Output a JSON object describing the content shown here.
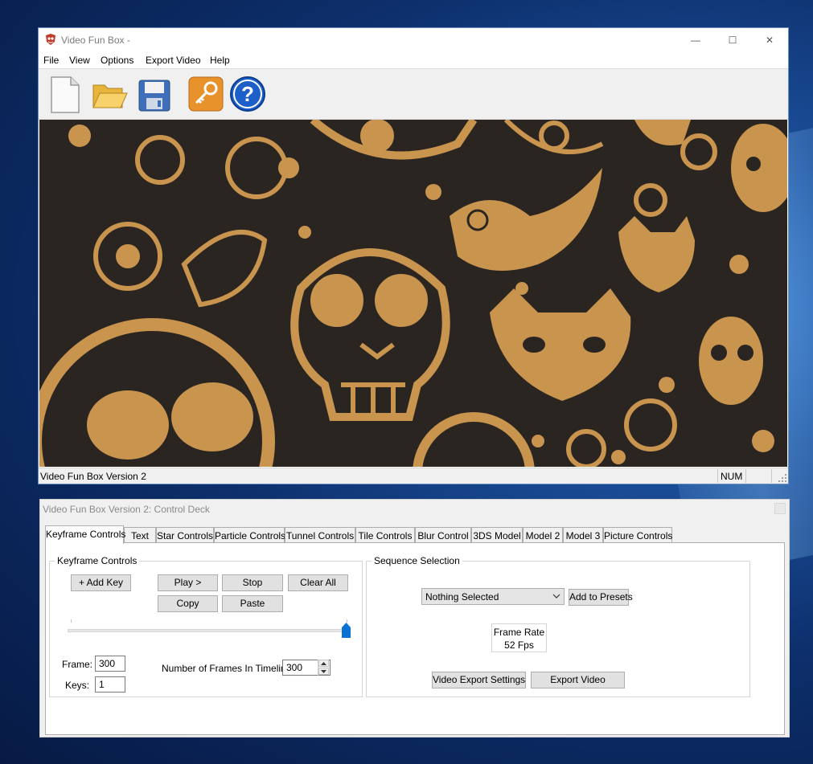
{
  "main_window": {
    "title": "Video Fun Box -",
    "caption_buttons": {
      "minimize": "—",
      "maximize": "☐",
      "close": "✕"
    },
    "menu": [
      "File",
      "View",
      "Options",
      "Export Video",
      "Help"
    ],
    "toolbar": [
      {
        "icon": "new-document-icon"
      },
      {
        "icon": "open-folder-icon"
      },
      {
        "icon": "save-floppy-icon"
      },
      {
        "icon": "key-icon"
      },
      {
        "icon": "help-icon",
        "glyph": "?"
      }
    ],
    "canvas": {
      "background": "#2b2522",
      "pattern_color": "#c8944e"
    },
    "status": {
      "text": "Video Fun Box Version 2",
      "num": "NUM"
    }
  },
  "control_deck": {
    "title": "Video Fun Box Version 2: Control Deck",
    "tabs": [
      "Keyframe Controls",
      "Text",
      "Star Controls",
      "Particle Controls",
      "Tunnel Controls",
      "Tile Controls",
      "Blur Control",
      "3DS Model",
      "Model 2",
      "Model 3",
      "Picture Controls"
    ],
    "active_tab": "Keyframe Controls",
    "keyframe_group": {
      "label": "Keyframe Controls",
      "buttons": {
        "add_key": "+ Add Key",
        "play": "Play >",
        "stop": "Stop",
        "clear_all": "Clear All",
        "copy": "Copy",
        "paste": "Paste"
      },
      "slider_level": 1.0,
      "frame_label": "Frame:",
      "frame_value": "300",
      "keys_label": "Keys:",
      "keys_value": "1",
      "frames_in_timeline_label": "Number of Frames In Timeline:",
      "frames_in_timeline_value": "300"
    },
    "sequence_group": {
      "label": "Sequence Selection",
      "dropdown_value": "Nothing Selected",
      "add_to_presets": "Add to Presets",
      "frame_rate_label": "Frame Rate",
      "frame_rate_value": "52 Fps",
      "video_export_settings": "Video Export Settings",
      "export_video": "Export Video"
    }
  },
  "colors": {
    "accent_blue": "#0078d7",
    "slider_thumb": "#0a72d4"
  }
}
